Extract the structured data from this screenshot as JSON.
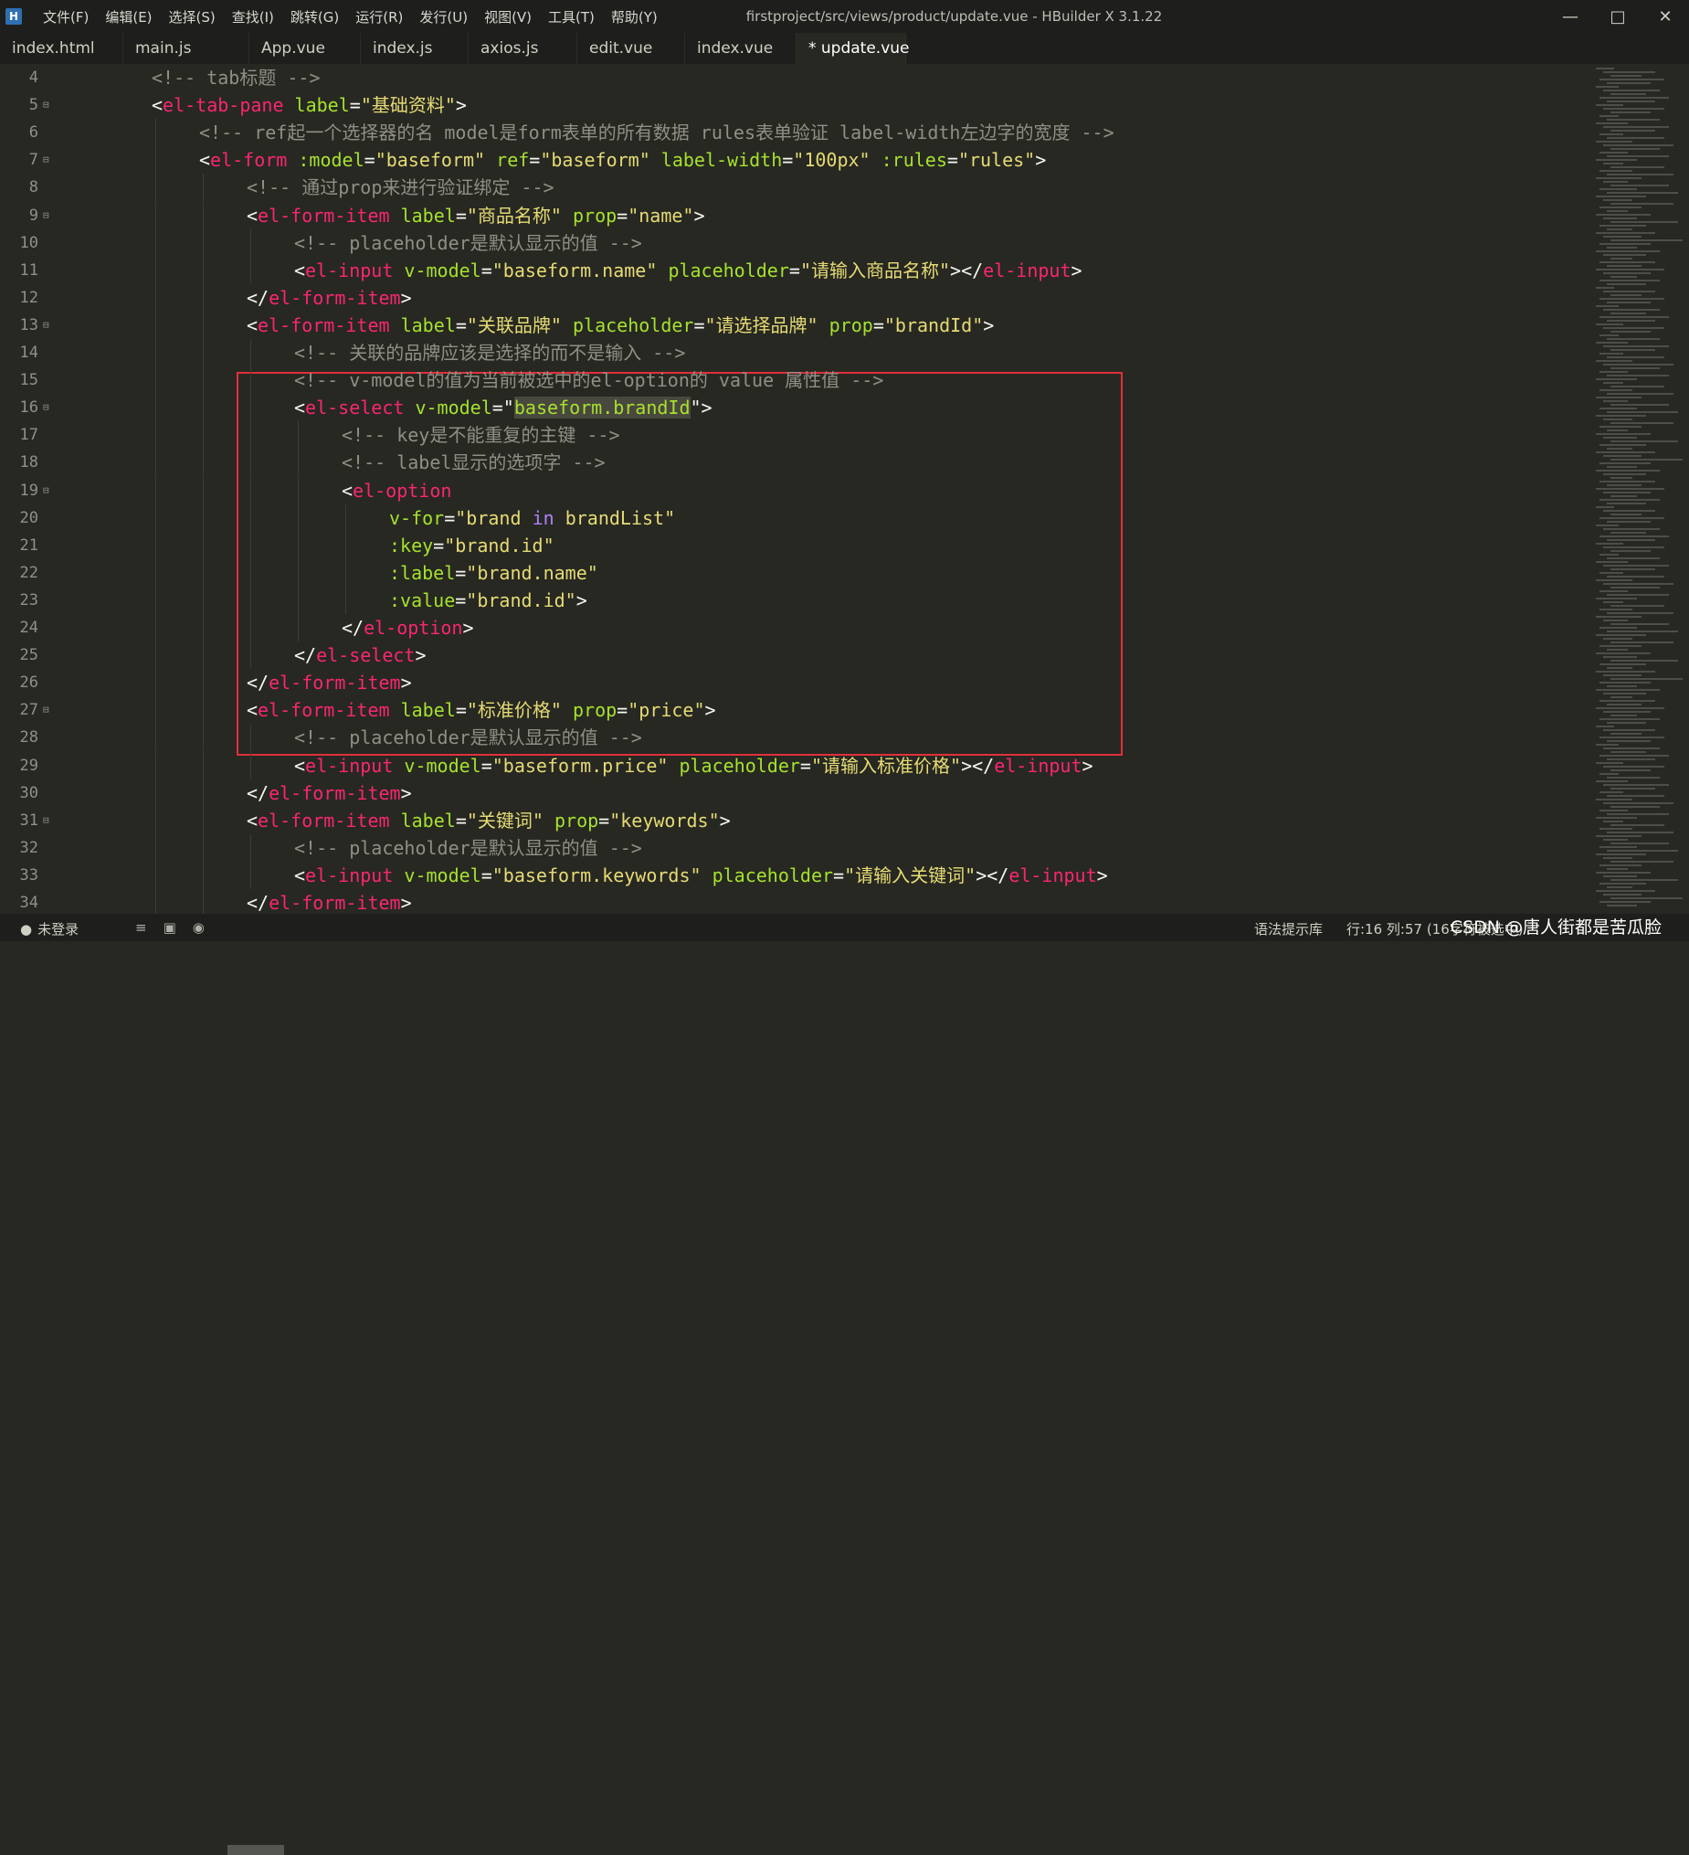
{
  "titlebar": {
    "menu": [
      "文件(F)",
      "编辑(E)",
      "选择(S)",
      "查找(I)",
      "跳转(G)",
      "运行(R)",
      "发行(U)",
      "视图(V)",
      "工具(T)",
      "帮助(Y)"
    ],
    "title": "firstproject/src/views/product/update.vue - HBuilder X 3.1.22",
    "logo_icon": "hbuilder-logo-icon"
  },
  "tabs": [
    {
      "label": "index.html"
    },
    {
      "label": "main.js"
    },
    {
      "label": "App.vue"
    },
    {
      "label": "index.js"
    },
    {
      "label": "axios.js"
    },
    {
      "label": "edit.vue"
    },
    {
      "label": "index.vue"
    },
    {
      "label": "* update.vue",
      "active": true
    }
  ],
  "lines": [
    {
      "n": "4",
      "fold": false,
      "indent": 0,
      "tokens": [
        [
          "cmt",
          "<!-- tab标题 -->"
        ]
      ]
    },
    {
      "n": "5",
      "fold": true,
      "indent": 0,
      "tokens": [
        [
          "pun",
          "<"
        ],
        [
          "tag",
          "el-tab-pane"
        ],
        [
          "pun",
          " "
        ],
        [
          "attr",
          "label"
        ],
        [
          "pun",
          "="
        ],
        [
          "str",
          "\"基础资料\""
        ],
        [
          "pun",
          ">"
        ]
      ]
    },
    {
      "n": "6",
      "fold": false,
      "indent": 1,
      "tokens": [
        [
          "cmt",
          "<!-- ref起一个选择器的名 model是form表单的所有数据 rules表单验证 label-width左边字的宽度 -->"
        ]
      ]
    },
    {
      "n": "7",
      "fold": true,
      "indent": 1,
      "tokens": [
        [
          "pun",
          "<"
        ],
        [
          "tag",
          "el-form"
        ],
        [
          "pun",
          " "
        ],
        [
          "attr",
          ":model"
        ],
        [
          "pun",
          "="
        ],
        [
          "str",
          "\"baseform\""
        ],
        [
          "pun",
          " "
        ],
        [
          "attr",
          "ref"
        ],
        [
          "pun",
          "="
        ],
        [
          "str",
          "\"baseform\""
        ],
        [
          "pun",
          " "
        ],
        [
          "attr",
          "label-width"
        ],
        [
          "pun",
          "="
        ],
        [
          "str",
          "\"100px\""
        ],
        [
          "pun",
          " "
        ],
        [
          "attr",
          ":rules"
        ],
        [
          "pun",
          "="
        ],
        [
          "str",
          "\"rules\""
        ],
        [
          "pun",
          ">"
        ]
      ]
    },
    {
      "n": "8",
      "fold": false,
      "indent": 2,
      "tokens": [
        [
          "cmt",
          "<!-- 通过prop来进行验证绑定 -->"
        ]
      ]
    },
    {
      "n": "9",
      "fold": true,
      "indent": 2,
      "tokens": [
        [
          "pun",
          "<"
        ],
        [
          "tag",
          "el-form-item"
        ],
        [
          "pun",
          " "
        ],
        [
          "attr",
          "label"
        ],
        [
          "pun",
          "="
        ],
        [
          "str",
          "\"商品名称\""
        ],
        [
          "pun",
          " "
        ],
        [
          "attr",
          "prop"
        ],
        [
          "pun",
          "="
        ],
        [
          "str",
          "\"name\""
        ],
        [
          "pun",
          ">"
        ]
      ]
    },
    {
      "n": "10",
      "fold": false,
      "indent": 3,
      "tokens": [
        [
          "cmt",
          "<!-- placeholder是默认显示的值 -->"
        ]
      ]
    },
    {
      "n": "11",
      "fold": false,
      "indent": 3,
      "tokens": [
        [
          "pun",
          "<"
        ],
        [
          "tag",
          "el-input"
        ],
        [
          "pun",
          " "
        ],
        [
          "attr",
          "v-model"
        ],
        [
          "pun",
          "="
        ],
        [
          "str",
          "\"baseform.name\""
        ],
        [
          "pun",
          " "
        ],
        [
          "attr",
          "placeholder"
        ],
        [
          "pun",
          "="
        ],
        [
          "str",
          "\"请输入商品名称\""
        ],
        [
          "pun",
          "></"
        ],
        [
          "tag",
          "el-input"
        ],
        [
          "pun",
          ">"
        ]
      ]
    },
    {
      "n": "12",
      "fold": false,
      "indent": 2,
      "tokens": [
        [
          "pun",
          "</"
        ],
        [
          "tag",
          "el-form-item"
        ],
        [
          "pun",
          ">"
        ]
      ]
    },
    {
      "n": "13",
      "fold": true,
      "indent": 2,
      "tokens": [
        [
          "pun",
          "<"
        ],
        [
          "tag",
          "el-form-item"
        ],
        [
          "pun",
          " "
        ],
        [
          "attr",
          "label"
        ],
        [
          "pun",
          "="
        ],
        [
          "str",
          "\"关联品牌\""
        ],
        [
          "pun",
          " "
        ],
        [
          "attr",
          "placeholder"
        ],
        [
          "pun",
          "="
        ],
        [
          "str",
          "\"请选择品牌\""
        ],
        [
          "pun",
          " "
        ],
        [
          "attr",
          "prop"
        ],
        [
          "pun",
          "="
        ],
        [
          "str",
          "\"brandId\""
        ],
        [
          "pun",
          ">"
        ]
      ]
    },
    {
      "n": "14",
      "fold": false,
      "indent": 3,
      "tokens": [
        [
          "cmt",
          "<!-- 关联的品牌应该是选择的而不是输入 -->"
        ]
      ]
    },
    {
      "n": "15",
      "fold": false,
      "indent": 3,
      "tokens": [
        [
          "cmt",
          "<!-- v-model的值为当前被选中的el-option的 value 属性值 -->"
        ]
      ]
    },
    {
      "n": "16",
      "fold": true,
      "indent": 3,
      "tokens": [
        [
          "pun",
          "<"
        ],
        [
          "tag",
          "el-select"
        ],
        [
          "pun",
          " "
        ],
        [
          "attr",
          "v-model"
        ],
        [
          "pun",
          "=\""
        ],
        [
          "sel",
          "baseform.brandId"
        ],
        [
          "pun",
          "\">"
        ]
      ]
    },
    {
      "n": "17",
      "fold": false,
      "indent": 4,
      "tokens": [
        [
          "cmt",
          "<!-- key是不能重复的主键 -->"
        ]
      ]
    },
    {
      "n": "18",
      "fold": false,
      "indent": 4,
      "tokens": [
        [
          "cmt",
          "<!-- label显示的选项字 -->"
        ]
      ]
    },
    {
      "n": "19",
      "fold": true,
      "indent": 4,
      "tokens": [
        [
          "pun",
          "<"
        ],
        [
          "tag",
          "el-option"
        ]
      ]
    },
    {
      "n": "20",
      "fold": false,
      "indent": 5,
      "tokens": [
        [
          "attr",
          "v-for"
        ],
        [
          "pun",
          "="
        ],
        [
          "str",
          "\"brand "
        ],
        [
          "kw",
          "in"
        ],
        [
          "str",
          " brandList\""
        ]
      ]
    },
    {
      "n": "21",
      "fold": false,
      "indent": 5,
      "tokens": [
        [
          "attr",
          ":key"
        ],
        [
          "pun",
          "="
        ],
        [
          "str",
          "\"brand.id\""
        ]
      ]
    },
    {
      "n": "22",
      "fold": false,
      "indent": 5,
      "tokens": [
        [
          "attr",
          ":label"
        ],
        [
          "pun",
          "="
        ],
        [
          "str",
          "\"brand.name\""
        ]
      ]
    },
    {
      "n": "23",
      "fold": false,
      "indent": 5,
      "tokens": [
        [
          "attr",
          ":value"
        ],
        [
          "pun",
          "="
        ],
        [
          "str",
          "\"brand.id\""
        ],
        [
          "pun",
          ">"
        ]
      ]
    },
    {
      "n": "24",
      "fold": false,
      "indent": 4,
      "tokens": [
        [
          "pun",
          "</"
        ],
        [
          "tag",
          "el-option"
        ],
        [
          "pun",
          ">"
        ]
      ]
    },
    {
      "n": "25",
      "fold": false,
      "indent": 3,
      "tokens": [
        [
          "pun",
          "</"
        ],
        [
          "tag",
          "el-select"
        ],
        [
          "pun",
          ">"
        ]
      ]
    },
    {
      "n": "26",
      "fold": false,
      "indent": 2,
      "tokens": [
        [
          "pun",
          "</"
        ],
        [
          "tag",
          "el-form-item"
        ],
        [
          "pun",
          ">"
        ]
      ]
    },
    {
      "n": "27",
      "fold": true,
      "indent": 2,
      "tokens": [
        [
          "pun",
          "<"
        ],
        [
          "tag",
          "el-form-item"
        ],
        [
          "pun",
          " "
        ],
        [
          "attr",
          "label"
        ],
        [
          "pun",
          "="
        ],
        [
          "str",
          "\"标准价格\""
        ],
        [
          "pun",
          " "
        ],
        [
          "attr",
          "prop"
        ],
        [
          "pun",
          "="
        ],
        [
          "str",
          "\"price\""
        ],
        [
          "pun",
          ">"
        ]
      ]
    },
    {
      "n": "28",
      "fold": false,
      "indent": 3,
      "tokens": [
        [
          "cmt",
          "<!-- placeholder是默认显示的值 -->"
        ]
      ]
    },
    {
      "n": "29",
      "fold": false,
      "indent": 3,
      "tokens": [
        [
          "pun",
          "<"
        ],
        [
          "tag",
          "el-input"
        ],
        [
          "pun",
          " "
        ],
        [
          "attr",
          "v-model"
        ],
        [
          "pun",
          "="
        ],
        [
          "str",
          "\"baseform.price\""
        ],
        [
          "pun",
          " "
        ],
        [
          "attr",
          "placeholder"
        ],
        [
          "pun",
          "="
        ],
        [
          "str",
          "\"请输入标准价格\""
        ],
        [
          "pun",
          "></"
        ],
        [
          "tag",
          "el-input"
        ],
        [
          "pun",
          ">"
        ]
      ]
    },
    {
      "n": "30",
      "fold": false,
      "indent": 2,
      "tokens": [
        [
          "pun",
          "</"
        ],
        [
          "tag",
          "el-form-item"
        ],
        [
          "pun",
          ">"
        ]
      ]
    },
    {
      "n": "31",
      "fold": true,
      "indent": 2,
      "tokens": [
        [
          "pun",
          "<"
        ],
        [
          "tag",
          "el-form-item"
        ],
        [
          "pun",
          " "
        ],
        [
          "attr",
          "label"
        ],
        [
          "pun",
          "="
        ],
        [
          "str",
          "\"关键词\""
        ],
        [
          "pun",
          " "
        ],
        [
          "attr",
          "prop"
        ],
        [
          "pun",
          "="
        ],
        [
          "str",
          "\"keywords\""
        ],
        [
          "pun",
          ">"
        ]
      ]
    },
    {
      "n": "32",
      "fold": false,
      "indent": 3,
      "tokens": [
        [
          "cmt",
          "<!-- placeholder是默认显示的值 -->"
        ]
      ]
    },
    {
      "n": "33",
      "fold": false,
      "indent": 3,
      "tokens": [
        [
          "pun",
          "<"
        ],
        [
          "tag",
          "el-input"
        ],
        [
          "pun",
          " "
        ],
        [
          "attr",
          "v-model"
        ],
        [
          "pun",
          "="
        ],
        [
          "str",
          "\"baseform.keywords\""
        ],
        [
          "pun",
          " "
        ],
        [
          "attr",
          "placeholder"
        ],
        [
          "pun",
          "="
        ],
        [
          "str",
          "\"请输入关键词\""
        ],
        [
          "pun",
          "></"
        ],
        [
          "tag",
          "el-input"
        ],
        [
          "pun",
          ">"
        ]
      ]
    },
    {
      "n": "34",
      "fold": false,
      "indent": 2,
      "tokens": [
        [
          "pun",
          "</"
        ],
        [
          "tag",
          "el-form-item"
        ],
        [
          "pun",
          ">"
        ]
      ]
    }
  ],
  "status": {
    "login": "未登录",
    "hint": "语法提示库",
    "position": "行:16  列:57 (16字符被选中)",
    "watermark": "CSDN @唐人街都是苦瓜脸"
  },
  "colors": {
    "background": "#272822",
    "tag": "#f92672",
    "attribute": "#a6e22e",
    "string": "#e6db74",
    "comment": "#908f87",
    "highlight_box": "#e0303a"
  }
}
